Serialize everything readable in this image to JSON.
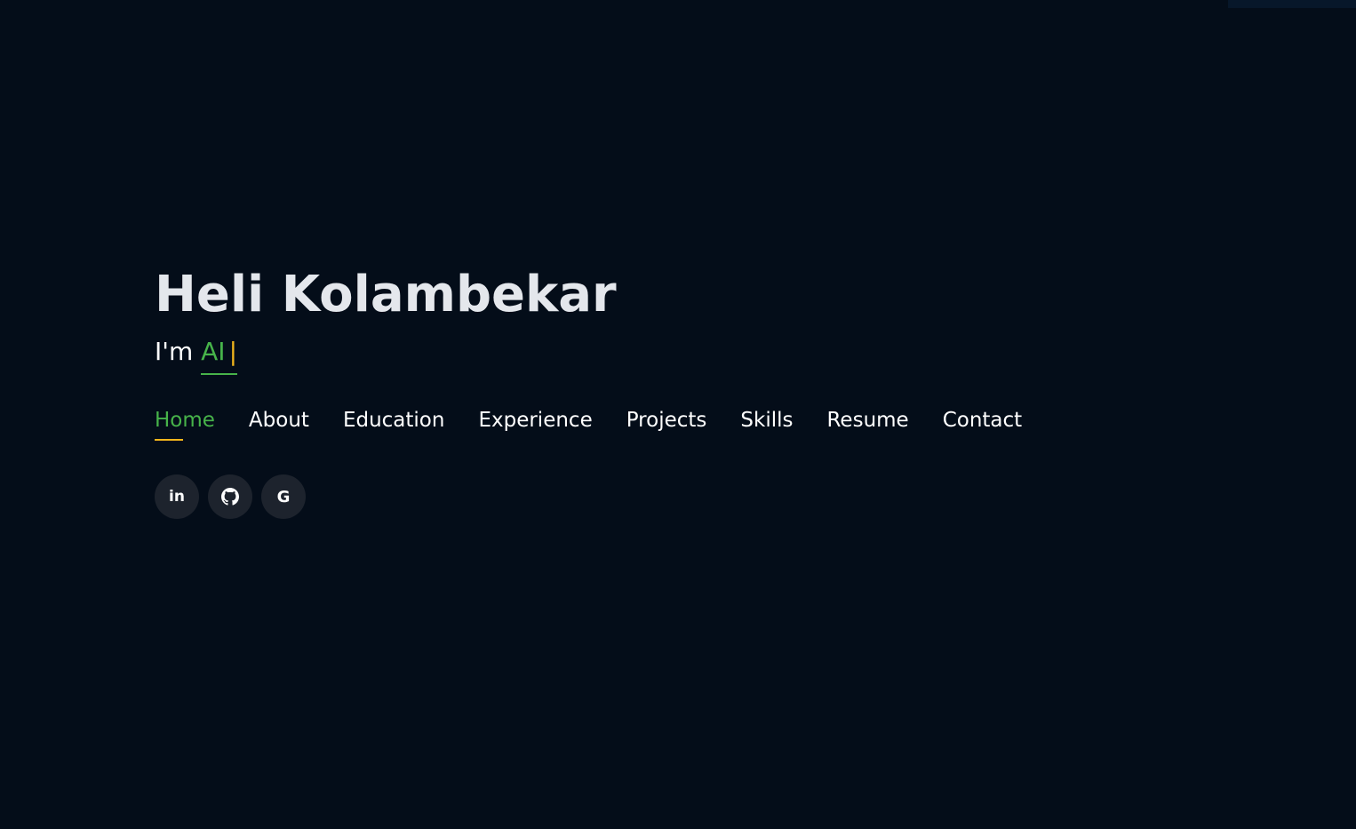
{
  "hero": {
    "name": "Heli Kolambekar",
    "tagline_prefix": "I'm ",
    "typed_text": "AI",
    "cursor": "|"
  },
  "nav": {
    "items": [
      {
        "label": "Home",
        "active": true
      },
      {
        "label": "About",
        "active": false
      },
      {
        "label": "Education",
        "active": false
      },
      {
        "label": "Experience",
        "active": false
      },
      {
        "label": "Projects",
        "active": false
      },
      {
        "label": "Skills",
        "active": false
      },
      {
        "label": "Resume",
        "active": false
      },
      {
        "label": "Contact",
        "active": false
      }
    ]
  },
  "social": [
    {
      "icon": "linkedin-icon",
      "glyph": "in"
    },
    {
      "icon": "github-icon"
    },
    {
      "icon": "google-icon",
      "glyph": "G"
    }
  ],
  "colors": {
    "background": "#040d19",
    "accent_green": "#47b34a",
    "accent_yellow": "#f1b51c",
    "name_text": "#e4e7ec",
    "social_bg": "#1d232d"
  }
}
